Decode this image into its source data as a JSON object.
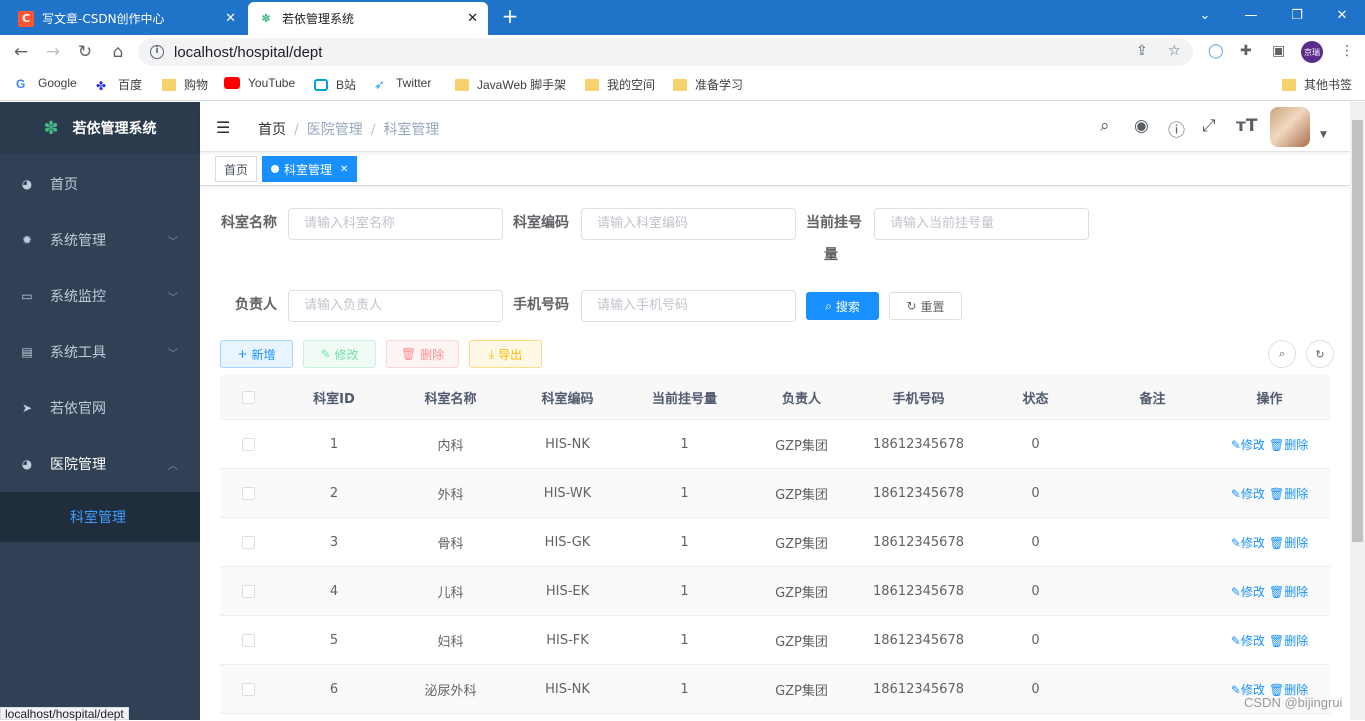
{
  "browser": {
    "tabs": [
      {
        "title": "写文章-CSDN创作中心",
        "favicon": "C"
      },
      {
        "title": "若依管理系统",
        "favicon": "leaf-icon"
      }
    ],
    "url": "localhost/hospital/dept",
    "profile_label": "京瑞",
    "bookmarks": [
      "Google",
      "百度",
      "购物",
      "YouTube",
      "B站",
      "Twitter",
      "JavaWeb 脚手架",
      "我的空间",
      "准备学习",
      "其他书签"
    ],
    "status_url": "localhost/hospital/dept"
  },
  "sidebar": {
    "logo": "若依管理系统",
    "items": [
      {
        "label": "首页",
        "icon": "dashboard-icon"
      },
      {
        "label": "系统管理",
        "icon": "gear-icon"
      },
      {
        "label": "系统监控",
        "icon": "monitor-icon"
      },
      {
        "label": "系统工具",
        "icon": "toolbox-icon"
      },
      {
        "label": "若依官网",
        "icon": "send-icon"
      },
      {
        "label": "医院管理",
        "icon": "dashboard-icon"
      }
    ],
    "sub_item": "科室管理"
  },
  "navbar": {
    "breadcrumb": [
      "首页",
      "医院管理",
      "科室管理"
    ]
  },
  "tags": [
    "首页",
    "科室管理"
  ],
  "form": {
    "dept_name_label": "科室名称",
    "dept_name_placeholder": "请输入科室名称",
    "dept_code_label": "科室编码",
    "dept_code_placeholder": "请输入科室编码",
    "reg_count_label": "当前挂号",
    "reg_count_label2": "量",
    "reg_count_placeholder": "请输入当前挂号量",
    "leader_label": "负责人",
    "leader_placeholder": "请输入负责人",
    "phone_label": "手机号码",
    "phone_placeholder": "请输入手机号码",
    "search_btn": "搜索",
    "reset_btn": "重置"
  },
  "toolbar": {
    "add": "新增",
    "edit": "修改",
    "delete": "删除",
    "export": "导出"
  },
  "table": {
    "headers": [
      "科室ID",
      "科室名称",
      "科室编码",
      "当前挂号量",
      "负责人",
      "手机号码",
      "状态",
      "备注",
      "操作"
    ],
    "rows": [
      {
        "id": "1",
        "name": "内科",
        "code": "HIS-NK",
        "count": "1",
        "leader": "GZP集团",
        "phone": "18612345678",
        "status": "0",
        "remark": ""
      },
      {
        "id": "2",
        "name": "外科",
        "code": "HIS-WK",
        "count": "1",
        "leader": "GZP集团",
        "phone": "18612345678",
        "status": "0",
        "remark": ""
      },
      {
        "id": "3",
        "name": "骨科",
        "code": "HIS-GK",
        "count": "1",
        "leader": "GZP集团",
        "phone": "18612345678",
        "status": "0",
        "remark": ""
      },
      {
        "id": "4",
        "name": "儿科",
        "code": "HIS-EK",
        "count": "1",
        "leader": "GZP集团",
        "phone": "18612345678",
        "status": "0",
        "remark": ""
      },
      {
        "id": "5",
        "name": "妇科",
        "code": "HIS-FK",
        "count": "1",
        "leader": "GZP集团",
        "phone": "18612345678",
        "status": "0",
        "remark": ""
      },
      {
        "id": "6",
        "name": "泌尿外科",
        "code": "HIS-NK",
        "count": "1",
        "leader": "GZP集团",
        "phone": "18612345678",
        "status": "0",
        "remark": ""
      }
    ],
    "edit_label": "修改",
    "delete_label": "删除"
  },
  "watermark": "CSDN @bijingrui",
  "colors": {
    "primary": "#1890ff",
    "sidebar": "#304156",
    "chrome": "#1f73c9"
  }
}
